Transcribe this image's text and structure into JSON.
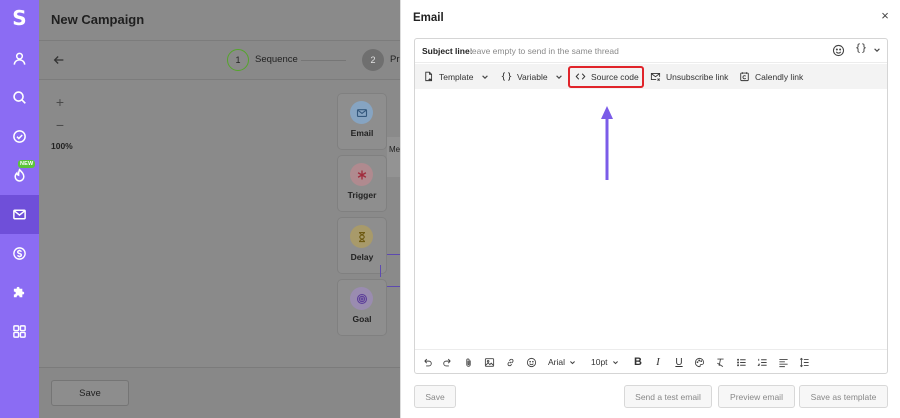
{
  "sidebar": {
    "logo": "S",
    "badge_new": "NEW",
    "items": [
      {
        "name": "user-icon"
      },
      {
        "name": "search-icon"
      },
      {
        "name": "check-circle-icon"
      },
      {
        "name": "flame-icon"
      },
      {
        "name": "mail-icon",
        "active": true
      },
      {
        "name": "dollar-icon"
      },
      {
        "name": "puzzle-icon"
      },
      {
        "name": "apps-icon"
      }
    ],
    "accent": "#8b6cf3",
    "active_color": "#6f4fd9"
  },
  "campaign": {
    "title": "New Campaign",
    "steps": [
      {
        "number": "1",
        "label": "Sequence"
      },
      {
        "number": "2",
        "label": "Pr"
      }
    ],
    "zoom_in": "+",
    "zoom_out": "−",
    "zoom_level": "100%",
    "nodes": [
      {
        "label": "Email",
        "icon": "mail-icon"
      },
      {
        "label": "Trigger",
        "icon": "asterisk-icon"
      },
      {
        "label": "Delay",
        "icon": "hourglass-icon"
      },
      {
        "label": "Goal",
        "icon": "target-icon"
      }
    ],
    "side_node_label": "Me",
    "save_label": "Save"
  },
  "email_drawer": {
    "title": "Email",
    "close": "×",
    "subject_label": "Subject line:",
    "subject_placeholder": "leave empty to send in the same thread",
    "subject_braces": "{}",
    "toolbar": {
      "template": "Template",
      "variable": "Variable",
      "source_code": "Source code",
      "unsubscribe": "Unsubscribe link",
      "calendly": "Calendly link"
    },
    "highlight_color": "#e0242a",
    "arrow_color": "#7b5ce8",
    "format": {
      "font": "Arial",
      "size": "10pt",
      "bold": "B",
      "italic": "I",
      "underline": "U"
    },
    "buttons": {
      "save": "Save",
      "send_test": "Send a test email",
      "preview": "Preview email",
      "save_template": "Save as template"
    }
  }
}
